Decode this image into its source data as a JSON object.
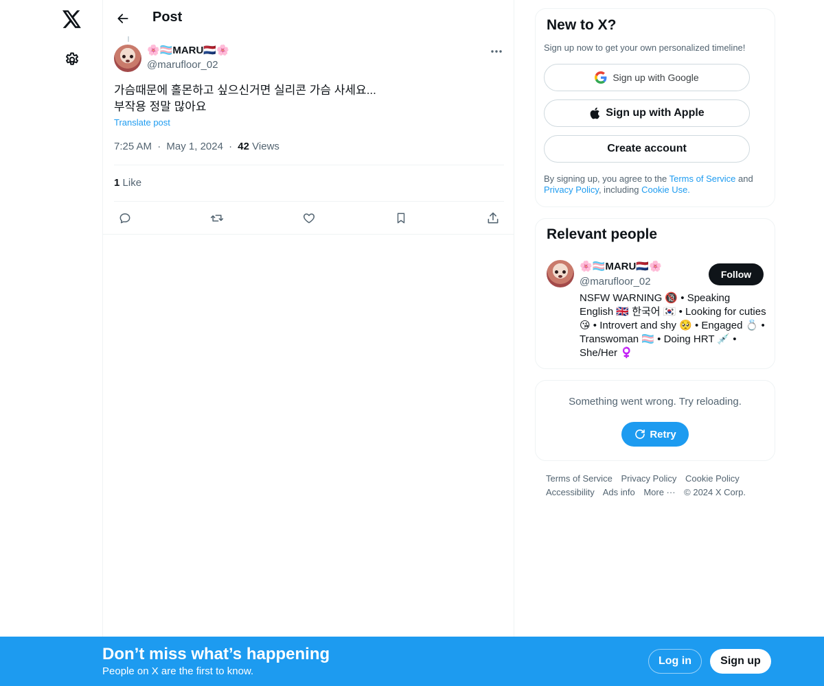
{
  "nav": {
    "logo_icon": "x-logo-icon",
    "settings_icon": "gear-icon"
  },
  "header": {
    "title": "Post",
    "back_icon": "arrow-left-icon"
  },
  "post": {
    "author_name": "🌸🏳️‍⚧️MARU🇳🇱🌸",
    "author_handle": "@marufloor_02",
    "text_line1": "가슴때문에 홀몬하고 싶으신거면 실리콘 가슴 사세요...",
    "text_line2": "부작용 정말 많아요",
    "translate_label": "Translate post",
    "time": "7:25 AM",
    "date": "May 1, 2024",
    "views_count": "42",
    "views_label": "Views",
    "likes_count": "1",
    "likes_label": "Like",
    "separator": "·"
  },
  "actions": {
    "reply_icon": "reply-icon",
    "repost_icon": "repost-icon",
    "like_icon": "heart-icon",
    "bookmark_icon": "bookmark-icon",
    "share_icon": "share-icon"
  },
  "signup_card": {
    "title": "New to X?",
    "subtitle": "Sign up now to get your own personalized timeline!",
    "google_label": "Sign up with Google",
    "apple_label": "Sign up with Apple",
    "create_label": "Create account",
    "legal_prefix": "By signing up, you agree to the ",
    "terms_link": "Terms of Service",
    "legal_and": " and ",
    "privacy_link": "Privacy Policy",
    "legal_including": ", including ",
    "cookie_link": "Cookie Use."
  },
  "people_card": {
    "title": "Relevant people",
    "name": "🌸🏳️‍⚧️MARU🇳🇱🌸",
    "handle": "@marufloor_02",
    "follow_label": "Follow",
    "bio": "NSFW WARNING 🔞 • Speaking English 🇬🇧 한국어 🇰🇷 • Looking for cuties 😘 • Introvert and shy 🥺 • Engaged 💍 • Transwoman 🏳️‍⚧️ • Doing HRT 💉 • She/Her ♀️"
  },
  "error_card": {
    "message": "Something went wrong. Try reloading.",
    "retry_label": "Retry"
  },
  "footer": {
    "links": [
      "Terms of Service",
      "Privacy Policy",
      "Cookie Policy",
      "Accessibility",
      "Ads info",
      "More ···",
      "© 2024 X Corp."
    ]
  },
  "bottom_bar": {
    "title": "Don’t miss what’s happening",
    "subtitle": "People on X are the first to know.",
    "login_label": "Log in",
    "signup_label": "Sign up"
  },
  "colors": {
    "accent": "#1d9bf0",
    "text": "#0f1419",
    "muted": "#536471"
  }
}
